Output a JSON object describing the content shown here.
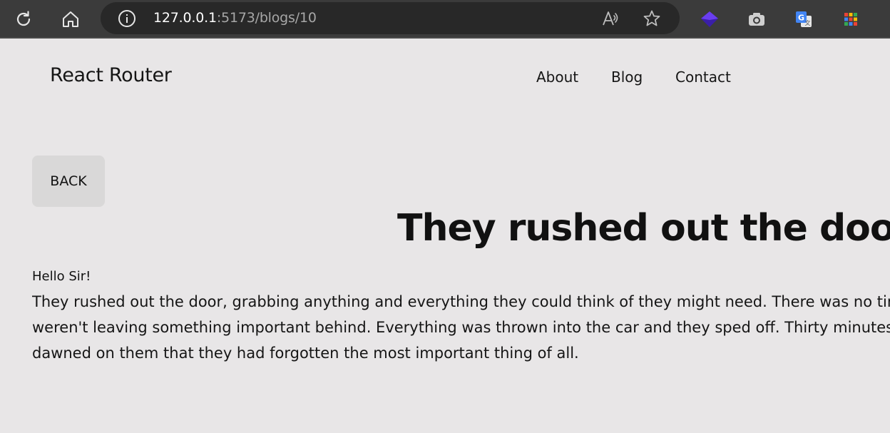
{
  "browser": {
    "url_host": "127.0.0.1",
    "url_path": ":5173/blogs/10",
    "icons": [
      "refresh-icon",
      "home-icon",
      "info-icon",
      "read-aloud-icon",
      "favorite-star-icon",
      "extension-diamond-icon",
      "camera-icon",
      "translate-icon",
      "apps-grid-icon"
    ]
  },
  "header": {
    "title": "React Router",
    "nav": [
      {
        "label": "About"
      },
      {
        "label": "Blog"
      },
      {
        "label": "Contact"
      }
    ]
  },
  "post": {
    "back_label": "BACK",
    "title": "They rushed out the door.",
    "greeting": "Hello Sir!",
    "body_lines": [
      "They rushed out the door, grabbing anything and everything they could think of they might need. There was no time to make sure they",
      "weren't leaving something important behind. Everything was thrown into the car and they sped off. Thirty minutes later they were well on their way when it",
      "dawned on them that they had forgotten the most important thing of all."
    ]
  },
  "colors": {
    "page_bg": "#e8e6e7",
    "toolbar_bg": "#3b3b3b",
    "address_bg": "#282828",
    "button_bg": "#d9d8d8"
  }
}
